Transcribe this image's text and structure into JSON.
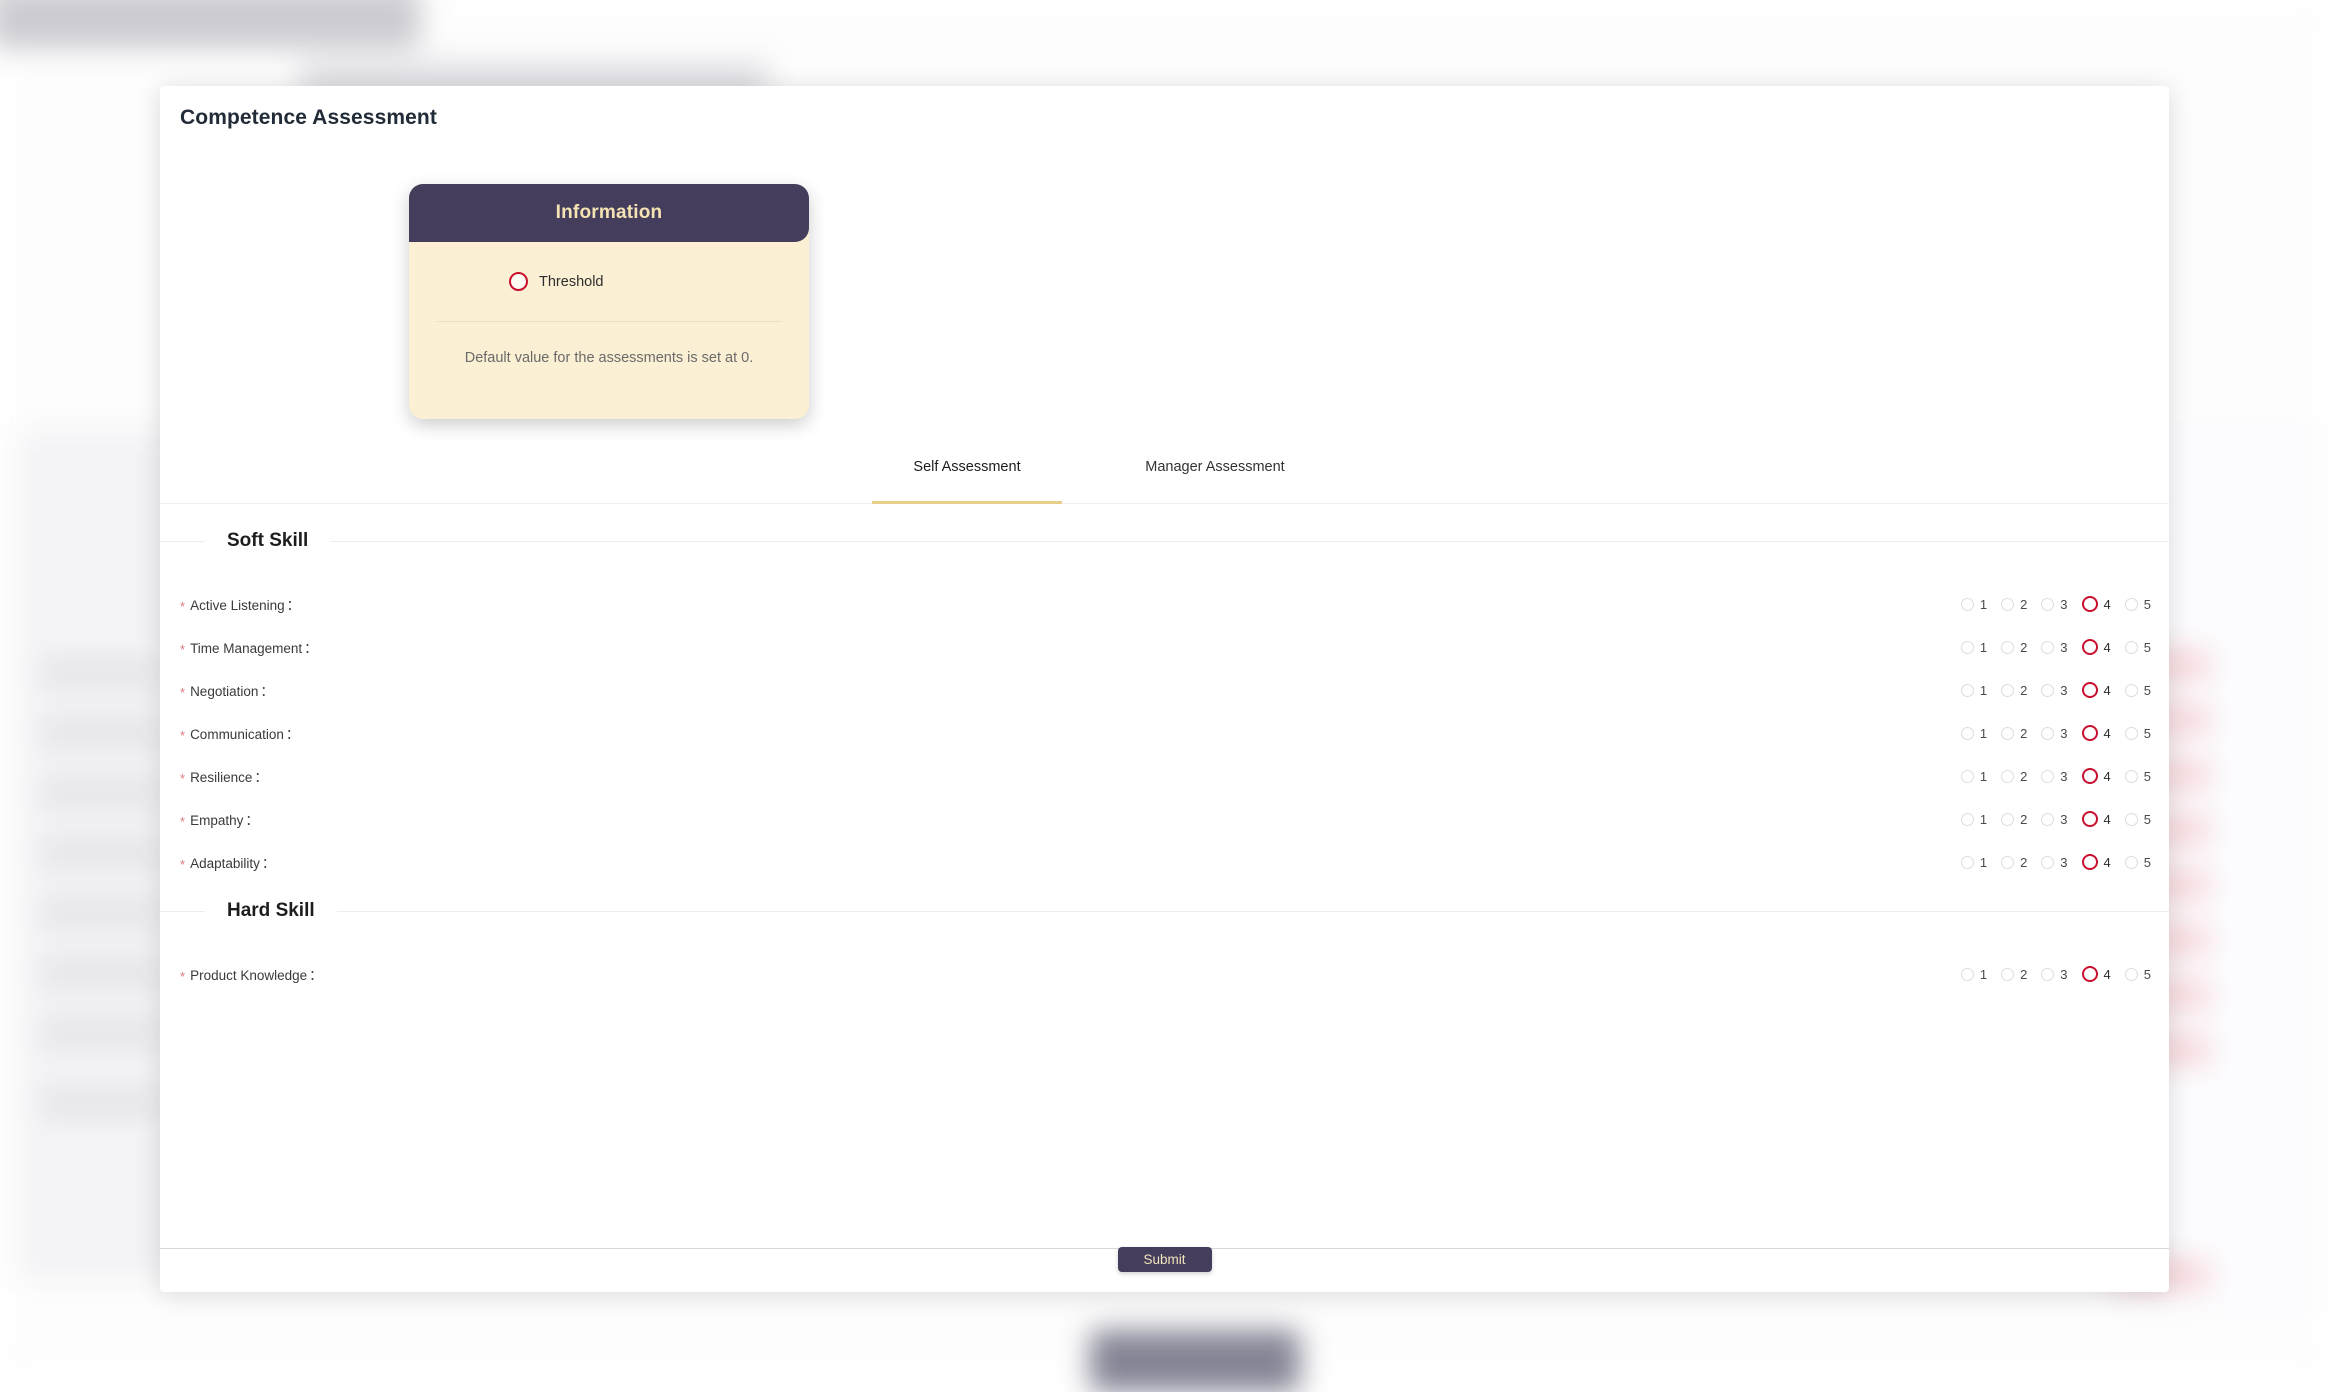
{
  "modal": {
    "title": "Competence Assessment"
  },
  "info_card": {
    "header": "Information",
    "threshold_label": "Threshold",
    "note": "Default value for the assessments is set at 0.",
    "header_bg": "#443e5c",
    "body_bg": "#fbf0d3",
    "header_text_color": "#f5e3b3",
    "threshold_ring_color": "#c8102e"
  },
  "tabs": [
    {
      "id": "self",
      "label": "Self Assessment",
      "active": true
    },
    {
      "id": "manager",
      "label": "Manager Assessment",
      "active": false
    }
  ],
  "tab_underline_color": "#e9d08a",
  "rating_scale": [
    "1",
    "2",
    "3",
    "4",
    "5"
  ],
  "sections": [
    {
      "id": "soft-skill",
      "title": "Soft Skill",
      "items": [
        {
          "label": "Active Listening",
          "required": true,
          "value": "4"
        },
        {
          "label": "Time Management",
          "required": true,
          "value": "4"
        },
        {
          "label": "Negotiation",
          "required": true,
          "value": "4"
        },
        {
          "label": "Communication",
          "required": true,
          "value": "4"
        },
        {
          "label": "Resilience",
          "required": true,
          "value": "4"
        },
        {
          "label": "Empathy",
          "required": true,
          "value": "4"
        },
        {
          "label": "Adaptability",
          "required": true,
          "value": "4"
        }
      ]
    },
    {
      "id": "hard-skill",
      "title": "Hard Skill",
      "items": [
        {
          "label": "Product Knowledge",
          "required": true,
          "value": "4"
        }
      ]
    }
  ],
  "footer": {
    "submit_label": "Submit",
    "submit_bg": "#443e5c",
    "submit_text_color": "#f3e4bd"
  }
}
